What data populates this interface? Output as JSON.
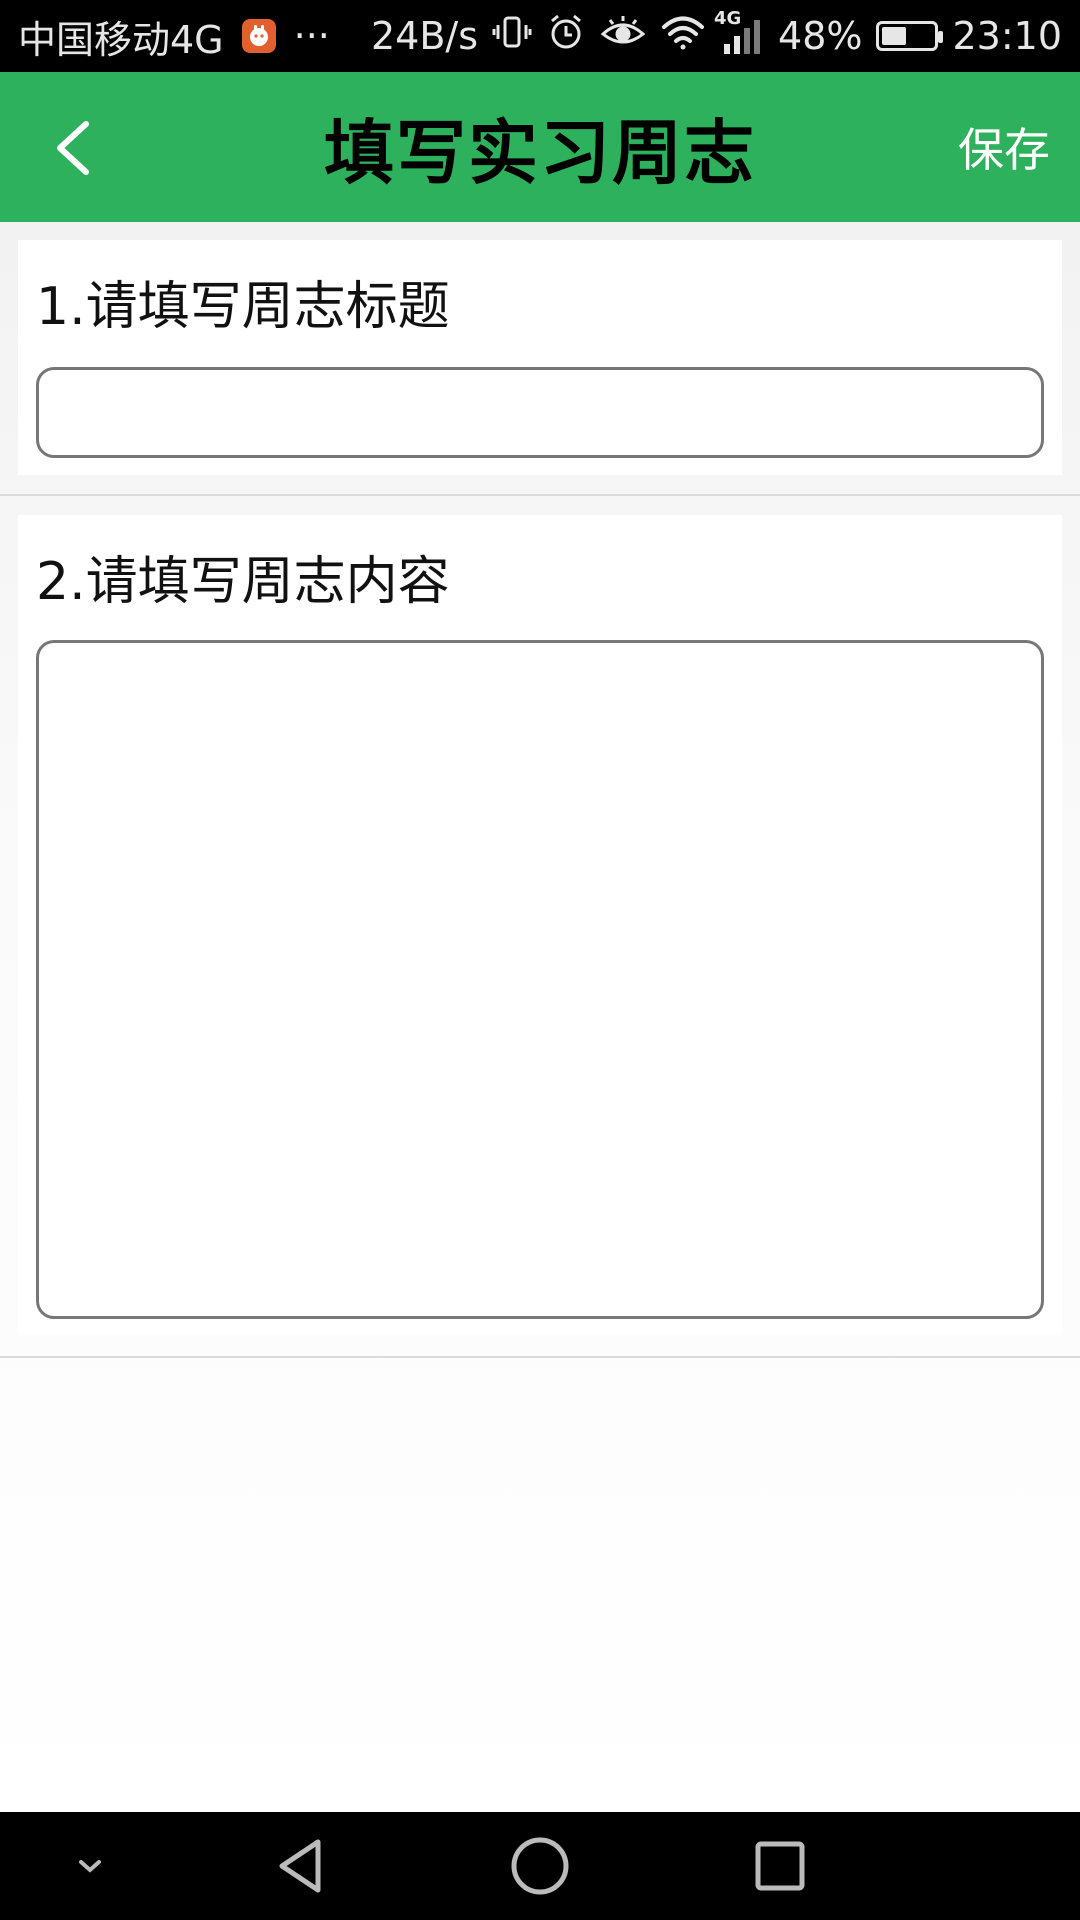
{
  "status_bar": {
    "carrier": "中国移动4G",
    "more": "···",
    "speed": "24B/s",
    "network_type": "4G",
    "battery_percent": "48%",
    "battery_level": 0.48,
    "time": "23:10",
    "icons": [
      "app-notification-icon",
      "vibrate-icon",
      "alarm-icon",
      "eye-icon",
      "wifi-icon",
      "signal-icon",
      "battery-icon"
    ]
  },
  "header": {
    "title": "填写实习周志",
    "save_label": "保存",
    "background": "#2db15d"
  },
  "form": {
    "title_section": {
      "label": "1.请填写周志标题",
      "value": "",
      "placeholder": ""
    },
    "content_section": {
      "label": "2.请填写周志内容",
      "value": "",
      "placeholder": ""
    }
  },
  "nav_bar": {
    "icons": [
      "chevron-down-icon",
      "back-triangle-icon",
      "home-circle-icon",
      "recents-square-icon"
    ]
  }
}
